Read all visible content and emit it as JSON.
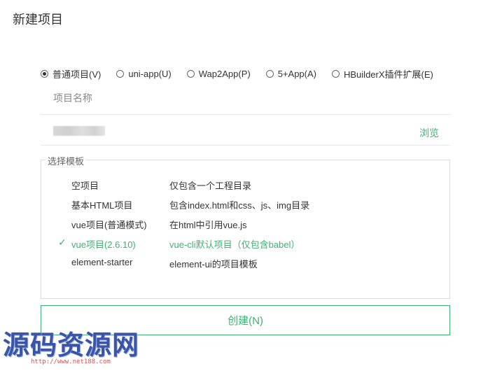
{
  "window": {
    "title": "新建项目"
  },
  "project_types": [
    {
      "label": "普通项目(V)",
      "checked": true
    },
    {
      "label": "uni-app(U)",
      "checked": false
    },
    {
      "label": "Wap2App(P)",
      "checked": false
    },
    {
      "label": "5+App(A)",
      "checked": false
    },
    {
      "label": "HBuilderX插件扩展(E)",
      "checked": false
    }
  ],
  "name_field": {
    "placeholder": "项目名称",
    "value": ""
  },
  "location_field": {
    "browse_label": "浏览"
  },
  "templates": {
    "legend": "选择模板",
    "items": [
      {
        "name": "空项目",
        "description": "仅包含一个工程目录",
        "selected": false
      },
      {
        "name": "基本HTML项目",
        "description": "包含index.html和css、js、img目录",
        "selected": false
      },
      {
        "name": "vue项目(普通模式)",
        "description": "在html中引用vue.js",
        "selected": false
      },
      {
        "name": "vue项目(2.6.10)",
        "description": "vue-cli默认项目（仅包含babel）",
        "selected": true
      },
      {
        "name": "element-starter",
        "description": "element-ui的项目模板",
        "selected": false
      }
    ]
  },
  "create_button": {
    "label": "创建(N)"
  },
  "watermark": {
    "text": "源码资源网",
    "url": "http://www.net188.com"
  },
  "colors": {
    "accent": "#3cb371",
    "watermark": "#3a55a8",
    "watermark_url": "#e05050"
  }
}
